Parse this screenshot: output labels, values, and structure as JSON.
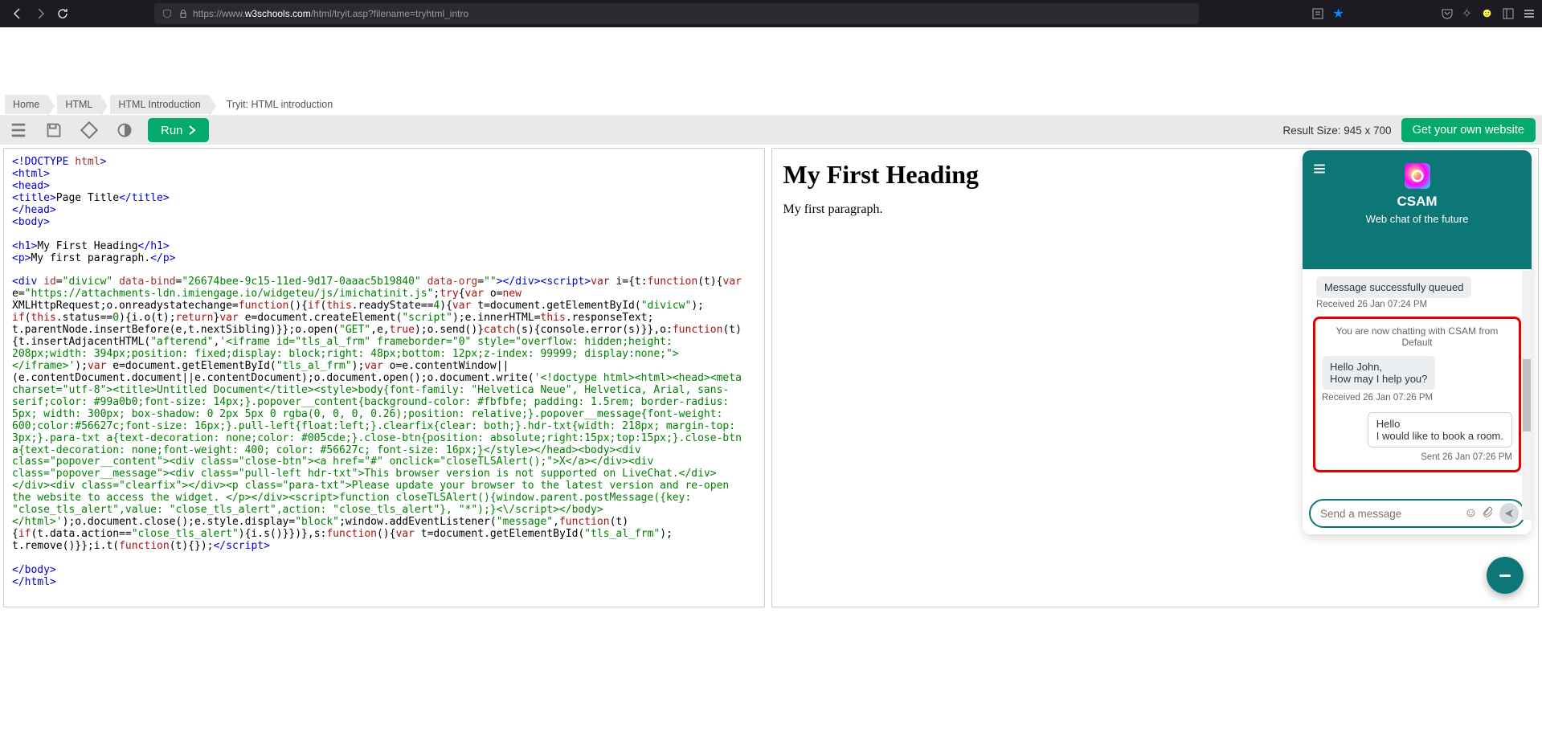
{
  "browser": {
    "url_prefix": "https://www.",
    "url_host": "w3schools.com",
    "url_path": "/html/tryit.asp?filename=tryhtml_intro"
  },
  "breadcrumb": [
    "Home",
    "HTML",
    "HTML Introduction",
    "Tryit: HTML introduction"
  ],
  "toolbar": {
    "run": "Run",
    "result_size": "Result Size: 945 x 700",
    "own": "Get your own website"
  },
  "code": {
    "syntax_tokens": "see-rendered-block"
  },
  "chart_data": null,
  "result": {
    "heading": "My First Heading",
    "para": "My first paragraph."
  },
  "chat": {
    "title": "CSAM",
    "subtitle": "Web chat of the future",
    "status_bubble": "Message successfully queued",
    "status_meta": "Received  26 Jan 07:24 PM",
    "info": "You are now chatting with CSAM from Default",
    "bot_line1": "Hello John,",
    "bot_line2": "How may I help you?",
    "bot_meta": "Received  26 Jan 07:26 PM",
    "user_line1": "Hello",
    "user_line2": "I would like to book a room.",
    "user_meta": "Sent  26 Jan 07:26 PM",
    "placeholder": "Send a message"
  }
}
